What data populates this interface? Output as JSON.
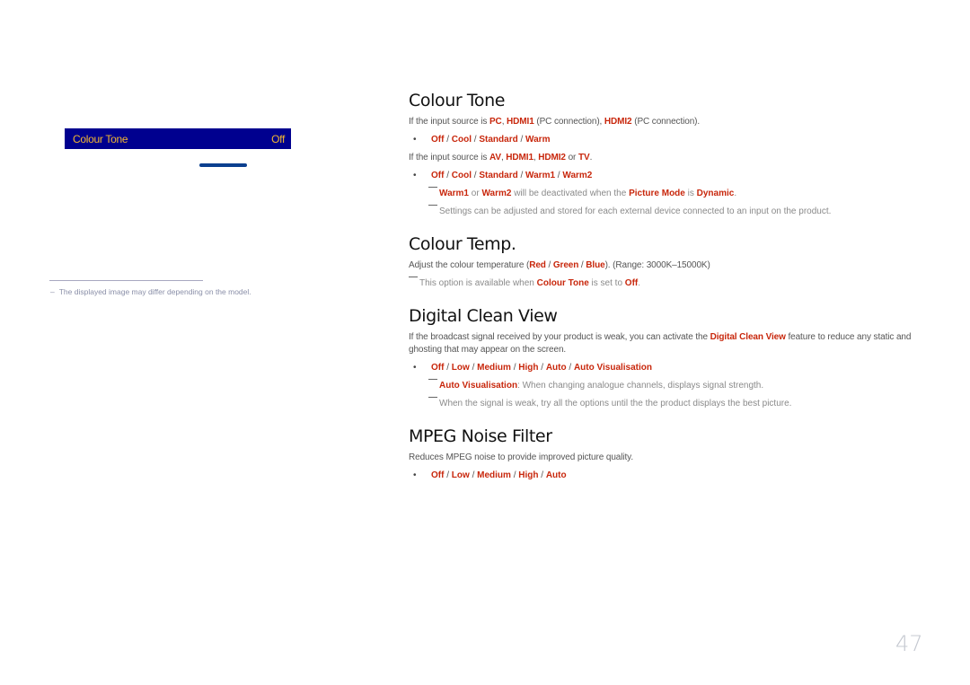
{
  "osd_menu": {
    "item_label": "Colour Tone",
    "item_value": "Off",
    "colors": {
      "background": "#00008f",
      "text": "#f2b632",
      "indicator": "#0b3f8f"
    }
  },
  "footnote": {
    "dash": "–",
    "text": "The displayed image may differ depending on the model."
  },
  "sections": {
    "colour_tone": {
      "title": "Colour Tone",
      "line1": {
        "pre": "If the input source is ",
        "pc": "PC",
        "sep1": ", ",
        "hdmi1": "HDMI1",
        "mid": " (PC connection), ",
        "hdmi2": "HDMI2",
        "post": " (PC connection)."
      },
      "options1": [
        "Off",
        "Cool",
        "Standard",
        "Warm"
      ],
      "line2": {
        "pre": "If the input source is ",
        "av": "AV",
        "sep1": ", ",
        "hdmi1": "HDMI1",
        "sep2": ", ",
        "hdmi2": "HDMI2",
        "or": " or ",
        "tv": "TV",
        "post": "."
      },
      "options2": [
        "Off",
        "Cool",
        "Standard",
        "Warm1",
        "Warm2"
      ],
      "note1": {
        "warm1": "Warm1",
        "or": " or ",
        "warm2": "Warm2",
        "mid": " will be deactivated when the ",
        "picture_mode": "Picture Mode",
        "is": " is ",
        "dynamic": "Dynamic",
        "post": "."
      },
      "note2": "Settings can be adjusted and stored for each external device connected to an input on the product."
    },
    "colour_temp": {
      "title": "Colour Temp.",
      "line": {
        "pre": "Adjust the colour temperature (",
        "red": "Red",
        "sep1": " / ",
        "green": "Green",
        "sep2": " / ",
        "blue": "Blue",
        "post": "). (Range: 3000K–15000K)"
      },
      "note": {
        "pre": "This option is available when ",
        "colour_tone": "Colour Tone",
        "mid": " is set to ",
        "off": "Off",
        "post": "."
      }
    },
    "digital_clean_view": {
      "title": "Digital Clean View",
      "line": {
        "pre": "If the broadcast signal received by your product is weak, you can activate the ",
        "dcv": "Digital Clean View",
        "post": " feature to reduce any static and ghosting that may appear on the screen."
      },
      "options": [
        "Off",
        "Low",
        "Medium",
        "High",
        "Auto",
        "Auto Visualisation"
      ],
      "note1": {
        "av": "Auto Visualisation",
        "post": ": When changing analogue channels, displays signal strength."
      },
      "note2": "When the signal is weak, try all the options until the the product displays the best picture."
    },
    "mpeg_noise_filter": {
      "title": "MPEG Noise Filter",
      "line": "Reduces MPEG noise to provide improved picture quality.",
      "options": [
        "Off",
        "Low",
        "Medium",
        "High",
        "Auto"
      ]
    }
  },
  "option_separator": " / ",
  "bullet": "•",
  "page_number": "47",
  "colors": {
    "highlight": "#c8270c",
    "body_text": "#555555",
    "note_text": "#8a8a8a"
  }
}
